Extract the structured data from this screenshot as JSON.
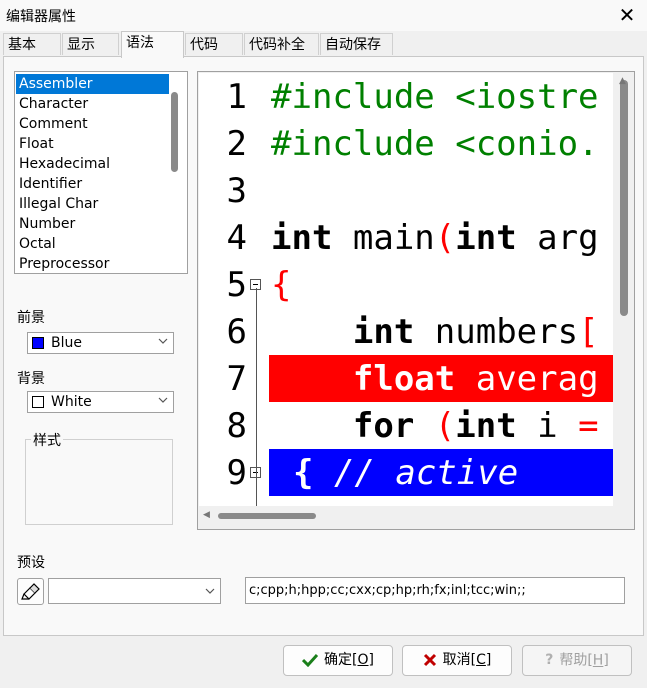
{
  "window": {
    "title": "编辑器属性"
  },
  "tabs": [
    {
      "label": "基本"
    },
    {
      "label": "显示"
    },
    {
      "label": "语法"
    },
    {
      "label": "代码"
    },
    {
      "label": "代码补全"
    },
    {
      "label": "自动保存"
    }
  ],
  "token_list": {
    "items": [
      "Assembler",
      "Character",
      "Comment",
      "Float",
      "Hexadecimal",
      "Identifier",
      "Illegal Char",
      "Number",
      "Octal",
      "Preprocessor"
    ],
    "selected": "Assembler"
  },
  "foreground": {
    "label": "前景",
    "value": "Blue",
    "color": "#0000ff"
  },
  "background": {
    "label": "背景",
    "value": "White",
    "color": "#ffffff"
  },
  "style_group": {
    "label": "样式"
  },
  "editor": {
    "line_numbers": [
      "1",
      "2",
      "3",
      "4",
      "5",
      "6",
      "7",
      "8",
      "9"
    ],
    "lines": [
      [
        "#include <iostre"
      ],
      [
        "#include <conio."
      ],
      [
        ""
      ],
      [
        "int",
        " main",
        "(",
        "int",
        " arg"
      ],
      [
        "{"
      ],
      [
        "    ",
        "int",
        " numbers",
        "["
      ],
      [
        "    ",
        "float",
        " averag"
      ],
      [
        "    ",
        "for",
        " ",
        "(",
        "int",
        " i ",
        "="
      ],
      [
        "{",
        " // active"
      ]
    ],
    "colors": {
      "preprocessor": "#008000",
      "symbol": "#ff0000",
      "highlight_error": "#ff0000",
      "highlight_active": "#0000ff"
    }
  },
  "presets": {
    "label": "预设",
    "selected_value": "",
    "extensions": "c;cpp;h;hpp;cc;cxx;cp;hp;rh;fx;inl;tcc;win;;"
  },
  "buttons": {
    "ok_label": "确定",
    "ok_key": "O",
    "cancel_label": "取消",
    "cancel_key": "C",
    "help_label": "帮助",
    "help_key": "H"
  }
}
